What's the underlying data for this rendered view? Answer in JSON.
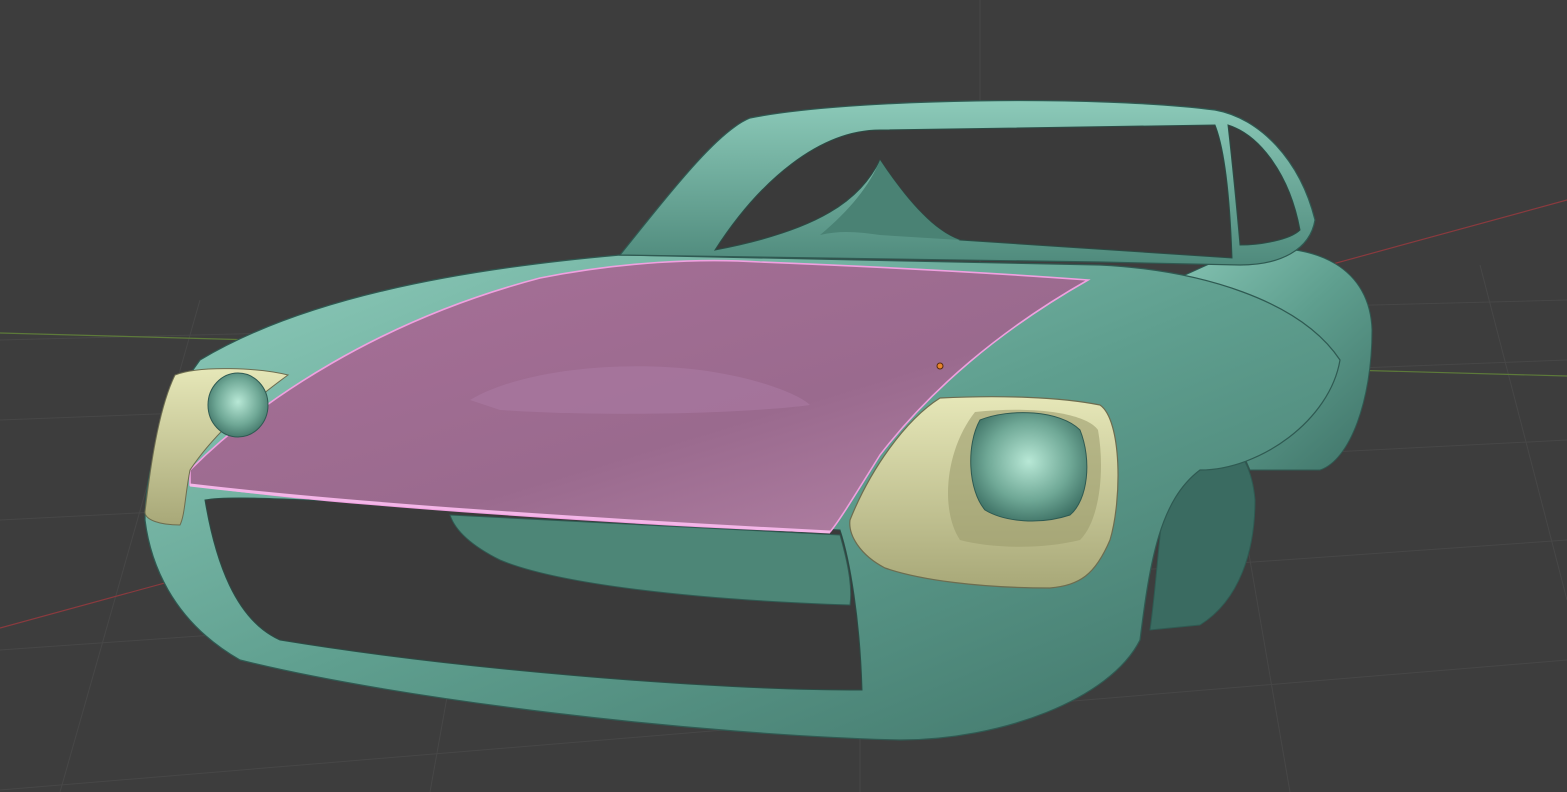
{
  "viewport": {
    "mode": "3d-viewport",
    "shading": "solid",
    "background": "#3d3d3d",
    "grid_color": "#4a4a4a",
    "axis_x_color": "#8a3a3e",
    "axis_y_color": "#5d7a3a"
  },
  "model": {
    "object": "car-body",
    "body_color": "#5f9f8f",
    "body_highlight": "#9fd8c8",
    "body_shadow": "#2f5a52",
    "selected_face_color": "#b07ca0",
    "selected_edge_color": "#f0a0e0",
    "headlight_bezel_color": "#d8d9a8",
    "headlight_lens_color": "#7fb8a8",
    "origin_point_color": "#e8842a"
  }
}
